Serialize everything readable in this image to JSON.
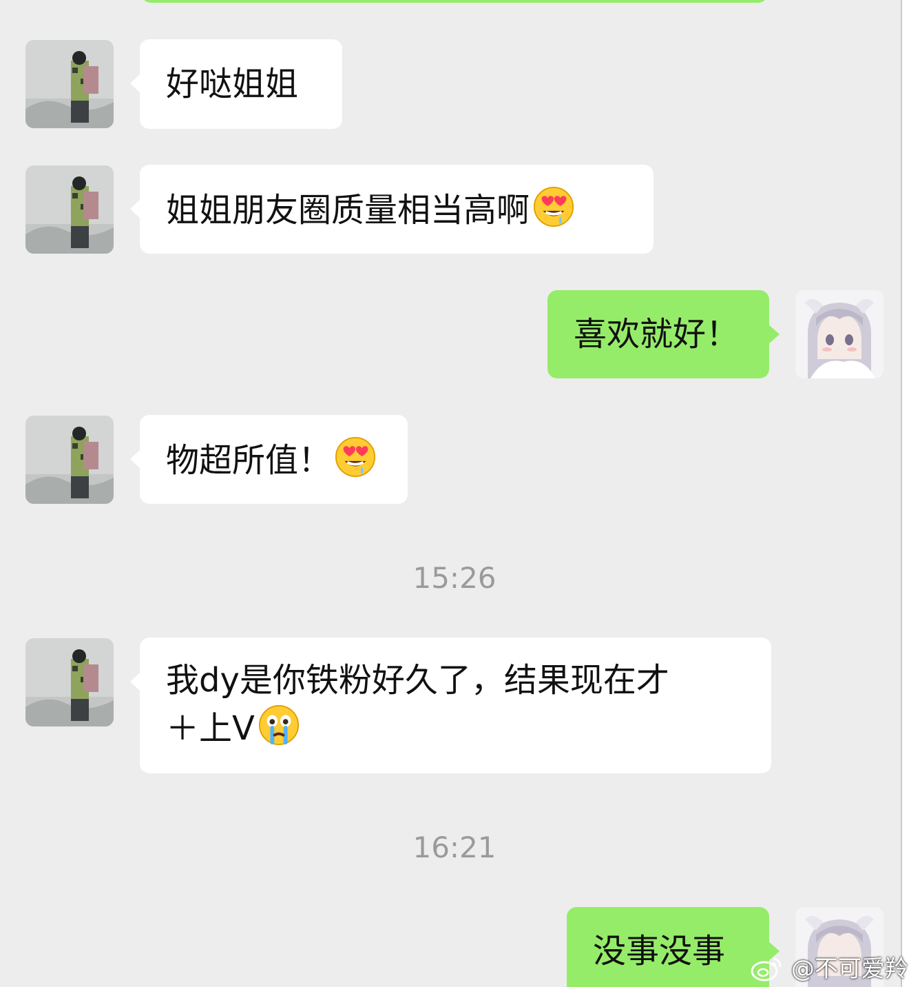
{
  "colors": {
    "background": "#ededed",
    "incoming_bubble": "#ffffff",
    "outgoing_bubble": "#95ec69",
    "timestamp_text": "#9a9a9a"
  },
  "messages": [
    {
      "direction": "incoming",
      "text": "好哒姐姐",
      "emoji": null
    },
    {
      "direction": "incoming",
      "text": "姐姐朋友圈质量相当高啊",
      "emoji": "heart-eyes-drool-icon"
    },
    {
      "direction": "outgoing",
      "text": "喜欢就好！",
      "emoji": null
    },
    {
      "direction": "incoming",
      "text": "物超所值！",
      "emoji": "heart-eyes-drool-icon"
    },
    {
      "direction": "incoming",
      "text_line1": "我dy是你铁粉好久了，结果现在才",
      "text_line2": "＋上V",
      "emoji": "crying-face-icon"
    },
    {
      "direction": "outgoing",
      "text": "没事没事",
      "emoji": null
    }
  ],
  "timestamps": [
    "15:26",
    "16:21"
  ],
  "watermark": {
    "icon": "weibo-logo-icon",
    "text": "@不可爱羚"
  }
}
